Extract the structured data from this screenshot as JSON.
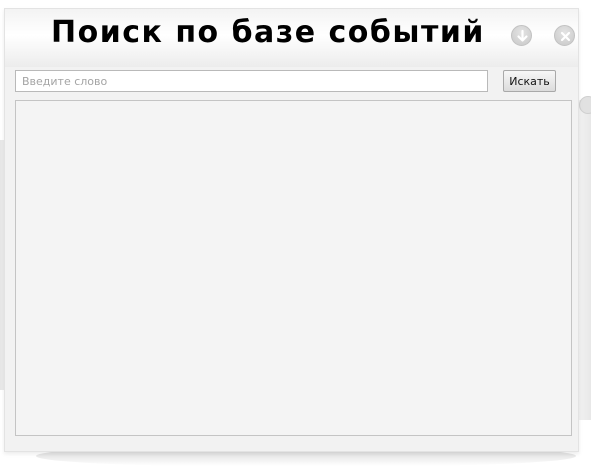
{
  "window": {
    "title": "Поиск по базе событий"
  },
  "search": {
    "placeholder": "Введите слово",
    "value": "",
    "button_label": "Искать"
  },
  "controls": {
    "minimize_icon": "arrow-down-circle-icon",
    "close_icon": "close-circle-icon"
  },
  "results": {
    "items": []
  }
}
